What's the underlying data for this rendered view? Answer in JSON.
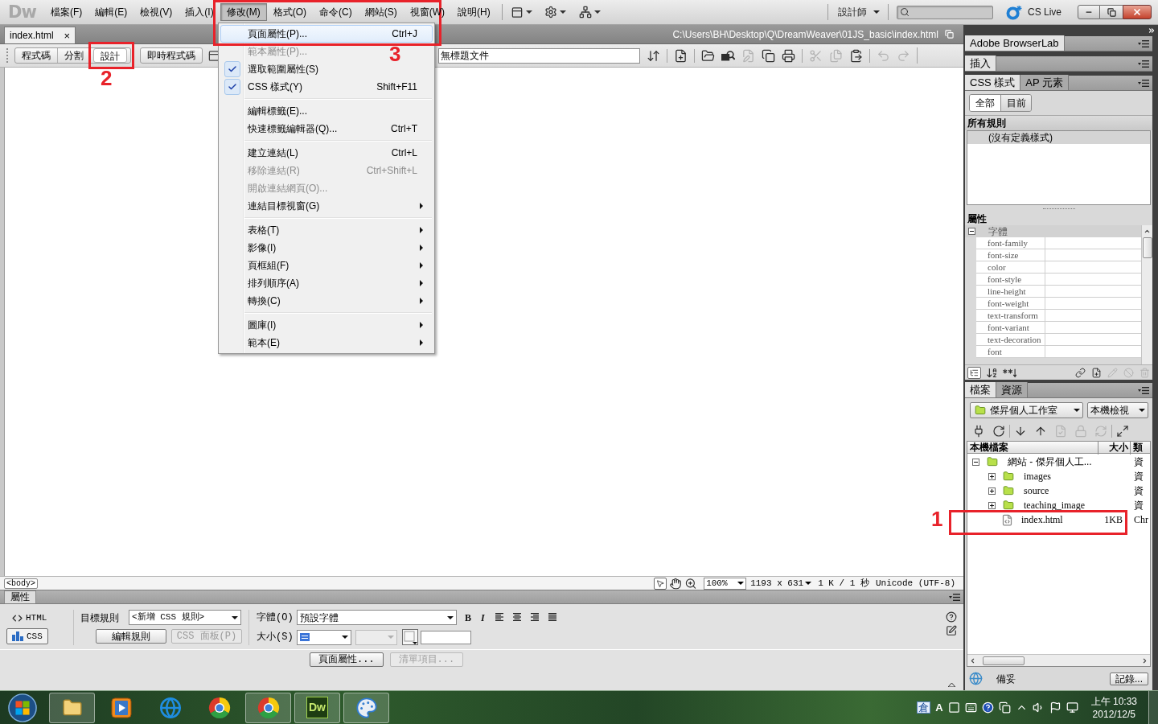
{
  "app_logo": "Dw",
  "menu_bar": [
    {
      "label": "檔案(F)",
      "selected": false
    },
    {
      "label": "編輯(E)",
      "selected": false
    },
    {
      "label": "檢視(V)",
      "selected": false
    },
    {
      "label": "插入(I)",
      "selected": false
    },
    {
      "label": "修改(M)",
      "selected": true
    },
    {
      "label": "格式(O)",
      "selected": false
    },
    {
      "label": "命令(C)",
      "selected": false
    },
    {
      "label": "網站(S)",
      "selected": false
    },
    {
      "label": "視窗(W)",
      "selected": false
    },
    {
      "label": "說明(H)",
      "selected": false
    }
  ],
  "workspace": {
    "label": "設計師"
  },
  "cs_live": {
    "label": "CS Live"
  },
  "document_tab": {
    "label": "index.html",
    "close": "×"
  },
  "document_path": "C:\\Users\\BH\\Desktop\\Q\\DreamWeaver\\01JS_basic\\index.html",
  "view_buttons": [
    {
      "label": "程式碼",
      "selected": false
    },
    {
      "label": "分割",
      "selected": false
    },
    {
      "label": "設計",
      "selected": true
    }
  ],
  "live_code_button": {
    "label": "即時程式碼"
  },
  "title_field": {
    "value": "無標題文件"
  },
  "document_toolbar": [
    [
      {
        "kind": "file-manage",
        "disabled": false
      }
    ],
    [
      {
        "kind": "new-file",
        "disabled": false
      }
    ],
    [
      {
        "kind": "preview",
        "disabled": false
      },
      {
        "kind": "bridge",
        "disabled": false
      },
      {
        "kind": "validate",
        "disabled": true
      },
      {
        "kind": "duplicate",
        "disabled": false
      },
      {
        "kind": "print",
        "disabled": false
      }
    ],
    [
      {
        "kind": "cut",
        "disabled": true
      },
      {
        "kind": "copy",
        "disabled": true
      },
      {
        "kind": "paste",
        "disabled": false
      }
    ],
    [
      {
        "kind": "undo",
        "disabled": true
      },
      {
        "kind": "redo",
        "disabled": true
      }
    ]
  ],
  "status_bar": {
    "tag": "<body>",
    "tools": [
      {
        "kind": "pointer",
        "selected": true
      },
      {
        "kind": "hand",
        "selected": false
      },
      {
        "kind": "zoom",
        "selected": false
      }
    ],
    "zoom": "100%",
    "window_size": "1193 x 631",
    "download": "1 K / 1 秒",
    "encoding": "Unicode (UTF-8)"
  },
  "properties_panel": {
    "title": "屬性",
    "mode_buttons": [
      {
        "kind": "html",
        "label": "HTML",
        "selected": false
      },
      {
        "kind": "css",
        "label": "CSS",
        "selected": true
      }
    ],
    "target_rule": {
      "label": "目標規則",
      "value": "<新增 CSS 規則>"
    },
    "rule_buttons": [
      {
        "label": "編輯規則",
        "disabled": false
      },
      {
        "label": "CSS 面板(P)",
        "disabled": true
      }
    ],
    "font": {
      "label": "字體(O)",
      "value": "預設字體"
    },
    "style_buttons": [
      {
        "label": "B"
      },
      {
        "label": "I"
      }
    ],
    "align_buttons": [
      {
        "kind": "left"
      },
      {
        "kind": "center"
      },
      {
        "kind": "right"
      },
      {
        "kind": "justify"
      }
    ],
    "size": {
      "label": "大小(S)"
    },
    "unit_select": {
      "disabled": true
    },
    "bottom_buttons": [
      {
        "label": "頁面屬性...",
        "disabled": false
      },
      {
        "label": "清單項目...",
        "disabled": true
      }
    ]
  },
  "modify_menu": {
    "groups": [
      [
        {
          "label": "頁面屬性(P)...",
          "shortcut": "Ctrl+J",
          "checked": false,
          "disabled": false,
          "submenu": false,
          "selected": true
        },
        {
          "label": "範本屬性(P)...",
          "checked": false,
          "disabled": true,
          "submenu": false,
          "selected": false
        },
        {
          "label": "選取範圍屬性(S)",
          "checked": true,
          "disabled": false,
          "submenu": false,
          "selected": false
        },
        {
          "label": "CSS 樣式(Y)",
          "shortcut": "Shift+F11",
          "checked": true,
          "disabled": false,
          "submenu": false,
          "selected": false
        }
      ],
      [
        {
          "label": "編輯標籤(E)...",
          "checked": false,
          "disabled": false,
          "submenu": false,
          "selected": false
        },
        {
          "label": "快速標籤編輯器(Q)...",
          "shortcut": "Ctrl+T",
          "checked": false,
          "disabled": false,
          "submenu": false,
          "selected": false
        }
      ],
      [
        {
          "label": "建立連結(L)",
          "shortcut": "Ctrl+L",
          "checked": false,
          "disabled": false,
          "submenu": false,
          "selected": false
        },
        {
          "label": "移除連結(R)",
          "shortcut": "Ctrl+Shift+L",
          "checked": false,
          "disabled": true,
          "submenu": false,
          "selected": false
        },
        {
          "label": "開啟連結網頁(O)...",
          "checked": false,
          "disabled": true,
          "submenu": false,
          "selected": false
        },
        {
          "label": "連結目標視窗(G)",
          "checked": false,
          "disabled": false,
          "submenu": true,
          "selected": false
        }
      ],
      [
        {
          "label": "表格(T)",
          "checked": false,
          "disabled": false,
          "submenu": true,
          "selected": false
        },
        {
          "label": "影像(I)",
          "checked": false,
          "disabled": false,
          "submenu": true,
          "selected": false
        },
        {
          "label": "頁框組(F)",
          "checked": false,
          "disabled": false,
          "submenu": true,
          "selected": false
        },
        {
          "label": "排列順序(A)",
          "checked": false,
          "disabled": false,
          "submenu": true,
          "selected": false
        },
        {
          "label": "轉換(C)",
          "checked": false,
          "disabled": false,
          "submenu": true,
          "selected": false
        }
      ],
      [
        {
          "label": "圖庫(I)",
          "checked": false,
          "disabled": false,
          "submenu": true,
          "selected": false
        },
        {
          "label": "範本(E)",
          "checked": false,
          "disabled": false,
          "submenu": true,
          "selected": false
        }
      ]
    ]
  },
  "panels": {
    "browserlab_tab": "Adobe BrowserLab",
    "insert_tab": "插入",
    "css_tabs": [
      {
        "label": "CSS 樣式",
        "selected": true
      },
      {
        "label": "AP 元素",
        "selected": false
      }
    ],
    "css_mode_buttons": [
      {
        "label": "全部",
        "selected": true
      },
      {
        "label": "目前",
        "selected": false
      }
    ],
    "rules_heading": "所有規則",
    "rules": [
      {
        "label": "(沒有定義樣式)",
        "selected": true
      }
    ],
    "properties_heading": "屬性",
    "property_groups": [
      {
        "label": "字體",
        "expanded": true,
        "properties": [
          "font-family",
          "font-size",
          "color",
          "font-style",
          "line-height",
          "font-weight",
          "text-transform",
          "font-variant",
          "text-decoration",
          "font"
        ]
      }
    ],
    "view_tools": [
      {
        "kind": "category-view",
        "selected": true
      },
      {
        "kind": "list-view",
        "selected": false
      },
      {
        "kind": "set-properties",
        "selected": false
      }
    ],
    "rule_tools": [
      {
        "kind": "attach",
        "disabled": false
      },
      {
        "kind": "new-rule",
        "disabled": false
      },
      {
        "kind": "edit",
        "disabled": true
      },
      {
        "kind": "disable",
        "disabled": true
      },
      {
        "kind": "delete",
        "disabled": true
      }
    ],
    "files_tabs": [
      {
        "label": "檔案",
        "selected": true
      },
      {
        "label": "資源",
        "selected": false
      }
    ],
    "site_select": {
      "value": "傑昇個人工作室"
    },
    "view_select": {
      "value": "本機檢視"
    },
    "files_tools": [
      [
        {
          "kind": "connect",
          "disabled": false
        },
        {
          "kind": "refresh",
          "disabled": false
        }
      ],
      [
        {
          "kind": "get",
          "disabled": false
        },
        {
          "kind": "put",
          "disabled": false
        },
        {
          "kind": "check-out",
          "disabled": true
        },
        {
          "kind": "check-in",
          "disabled": true
        },
        {
          "kind": "sync",
          "disabled": true
        }
      ],
      [
        {
          "kind": "expand",
          "disabled": false
        }
      ]
    ],
    "files_columns": [
      "本機檔案",
      "大小",
      "類"
    ],
    "files_tree": [
      {
        "kind": "site",
        "name": "網站 - 傑昇個人工...",
        "type": "資",
        "expanded": true,
        "children": [
          {
            "kind": "folder",
            "name": "images",
            "type": "資",
            "expanded": false
          },
          {
            "kind": "folder",
            "name": "source",
            "type": "資",
            "expanded": false
          },
          {
            "kind": "folder",
            "name": "teaching_image",
            "type": "資",
            "expanded": false
          },
          {
            "kind": "file",
            "name": "index.html",
            "size": "1KB",
            "type": "Chr"
          }
        ]
      }
    ],
    "status": "備妥",
    "log_button": "記錄..."
  },
  "taskbar": {
    "apps": [
      {
        "kind": "explorer",
        "running": true
      },
      {
        "kind": "media",
        "running": false
      },
      {
        "kind": "browser-e",
        "running": false
      },
      {
        "kind": "browser-round",
        "running": false
      },
      {
        "kind": "browser-round",
        "running": true
      },
      {
        "kind": "dreamweaver",
        "label": "Dw",
        "running": true
      },
      {
        "kind": "paint",
        "running": true
      }
    ],
    "ime": [
      "倉",
      "A"
    ],
    "tray_icons": [
      {
        "kind": "panel"
      },
      {
        "kind": "keyboard"
      },
      {
        "kind": "help"
      },
      {
        "kind": "windows"
      },
      {
        "kind": "chevron"
      },
      {
        "kind": "volume"
      },
      {
        "kind": "flag"
      },
      {
        "kind": "network"
      }
    ],
    "time": "上午 10:33",
    "date": "2012/12/5"
  },
  "annotations": [
    {
      "label": "1"
    },
    {
      "label": "2"
    },
    {
      "label": "3"
    }
  ]
}
